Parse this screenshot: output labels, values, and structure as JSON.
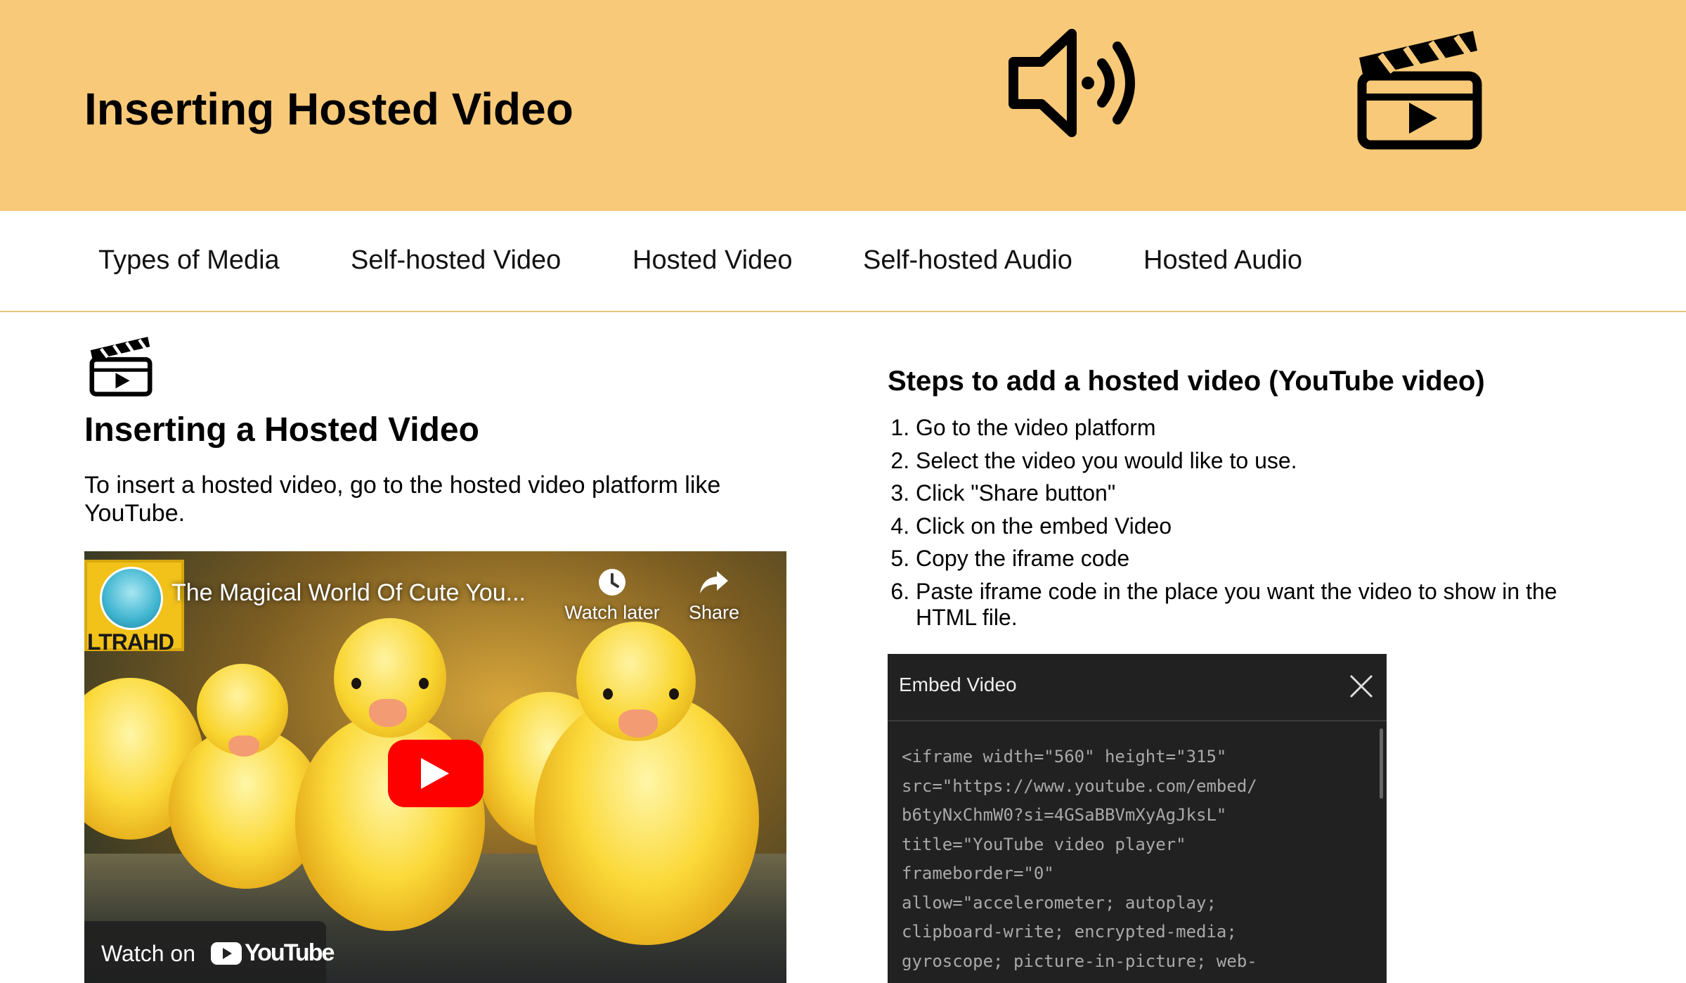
{
  "header": {
    "title": "Inserting Hosted Video",
    "icons": [
      "speaker-icon",
      "clapperboard-icon"
    ]
  },
  "nav": {
    "items": [
      {
        "label": "Types of Media"
      },
      {
        "label": "Self-hosted Video"
      },
      {
        "label": "Hosted Video"
      },
      {
        "label": "Self-hosted Audio"
      },
      {
        "label": "Hosted Audio"
      }
    ]
  },
  "main": {
    "section_icon": "clapperboard-icon",
    "section_title": "Inserting a Hosted Video",
    "intro": "To insert a hosted video, go to the hosted video platform like YouTube."
  },
  "video": {
    "title": "The Magical World Of Cute You...",
    "badge": "LTRAHD",
    "watch_later": "Watch later",
    "share": "Share",
    "watch_on": "Watch on",
    "platform": "YouTube"
  },
  "steps": {
    "title": "Steps to add a hosted video (YouTube video)",
    "items": [
      "Go to the video platform",
      "Select the video you would like to use.",
      "Click \"Share button\"",
      "Click on the embed Video",
      "Copy the iframe code",
      "Paste iframe code in the place you want the video to show in the HTML file."
    ]
  },
  "embed": {
    "title": "Embed Video",
    "code": "<iframe width=\"560\" height=\"315\"\nsrc=\"https://www.youtube.com/embed/\nb6tyNxChmW0?si=4GSaBBVmXyAgJksL\"\ntitle=\"YouTube video player\"\nframeborder=\"0\"\nallow=\"accelerometer; autoplay;\nclipboard-write; encrypted-media;\ngyroscope; picture-in-picture; web-"
  },
  "colors": {
    "header_bg": "#f8c978",
    "nav_border": "#e9c27b",
    "dialog_bg": "#212121",
    "youtube_red": "#ff0000"
  }
}
